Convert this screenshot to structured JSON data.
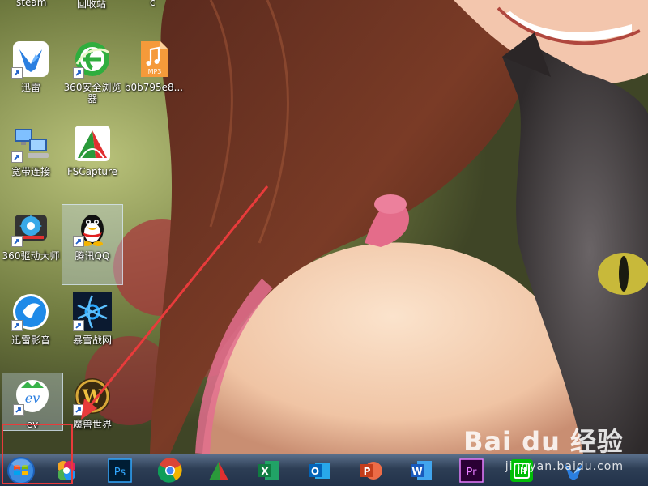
{
  "desktop": {
    "top_labels": [
      "steam",
      "回收站",
      "c"
    ],
    "icons": [
      {
        "label": "迅雷",
        "icon": "xunlei-bird-icon"
      },
      {
        "label": "360安全浏览器",
        "icon": "360-browser-icon"
      },
      {
        "label": "b0b795e8...",
        "icon": "mp3-file-icon",
        "badge": "MP3"
      },
      {
        "label": "宽带连接",
        "icon": "network-connection-icon"
      },
      {
        "label": "FSCapture",
        "icon": "fscapture-icon"
      },
      {
        "label": "360驱动大师",
        "icon": "360-driver-icon"
      },
      {
        "label": "腾讯QQ",
        "icon": "qq-penguin-icon"
      },
      {
        "label": "迅雷影音",
        "icon": "xunlei-player-icon"
      },
      {
        "label": "暴雪战网",
        "icon": "battlenet-icon"
      },
      {
        "label": "ev",
        "icon": "ev-recorder-icon"
      },
      {
        "label": "魔兽世界",
        "icon": "wow-icon"
      }
    ]
  },
  "taskbar": {
    "start": "windows-start-orb-icon",
    "items": [
      {
        "name": "app-launcher-icon"
      },
      {
        "name": "photoshop-icon",
        "text": "Ps"
      },
      {
        "name": "chrome-icon"
      },
      {
        "name": "fscapture-icon"
      },
      {
        "name": "excel-icon",
        "text": "X"
      },
      {
        "name": "outlook-icon",
        "text": "O"
      },
      {
        "name": "powerpoint-icon",
        "text": "P"
      },
      {
        "name": "word-icon",
        "text": "W"
      },
      {
        "name": "premiere-icon",
        "text": "Pr"
      },
      {
        "name": "iqiyi-icon"
      },
      {
        "name": "xunlei-icon"
      }
    ]
  },
  "watermark": {
    "main": "Bai du 经验",
    "sub": "jingyan.baidu.com"
  },
  "colors": {
    "annotation": "#e83b3b",
    "taskbar": "#2d3e55"
  }
}
